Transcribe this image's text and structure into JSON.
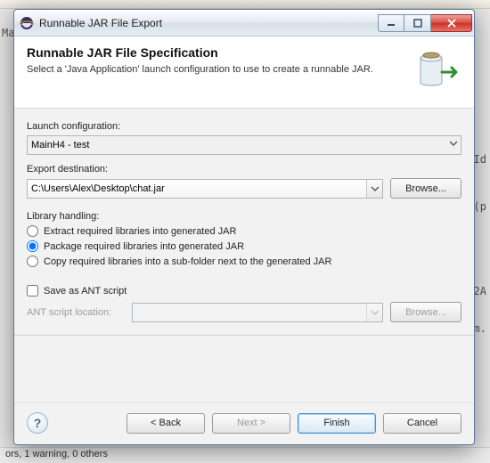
{
  "window": {
    "title": "Runnable JAR File Export"
  },
  "header": {
    "title": "Runnable JAR File Specification",
    "description": "Select a 'Java Application' launch configuration to use to create a runnable JAR."
  },
  "launch": {
    "label": "Launch configuration:",
    "value": "MainH4 - test"
  },
  "export": {
    "label": "Export destination:",
    "value": "C:\\Users\\Alex\\Desktop\\chat.jar",
    "browse": "Browse..."
  },
  "library": {
    "label": "Library handling:",
    "options": [
      "Extract required libraries into generated JAR",
      "Package required libraries into generated JAR",
      "Copy required libraries into a sub-folder next to the generated JAR"
    ],
    "selected": 1
  },
  "ant": {
    "checkbox": "Save as ANT script",
    "label": "ANT script location:",
    "browse": "Browse...",
    "value": ""
  },
  "footer": {
    "back": "< Back",
    "next": "Next >",
    "finish": "Finish",
    "cancel": "Cancel"
  },
  "bg": {
    "status": "ors, 1 warning, 0 others",
    "frag1": "Ma",
    "frag2": "tId",
    "frag3": "t(p",
    "frag4": "2A",
    "frag5": "m."
  }
}
